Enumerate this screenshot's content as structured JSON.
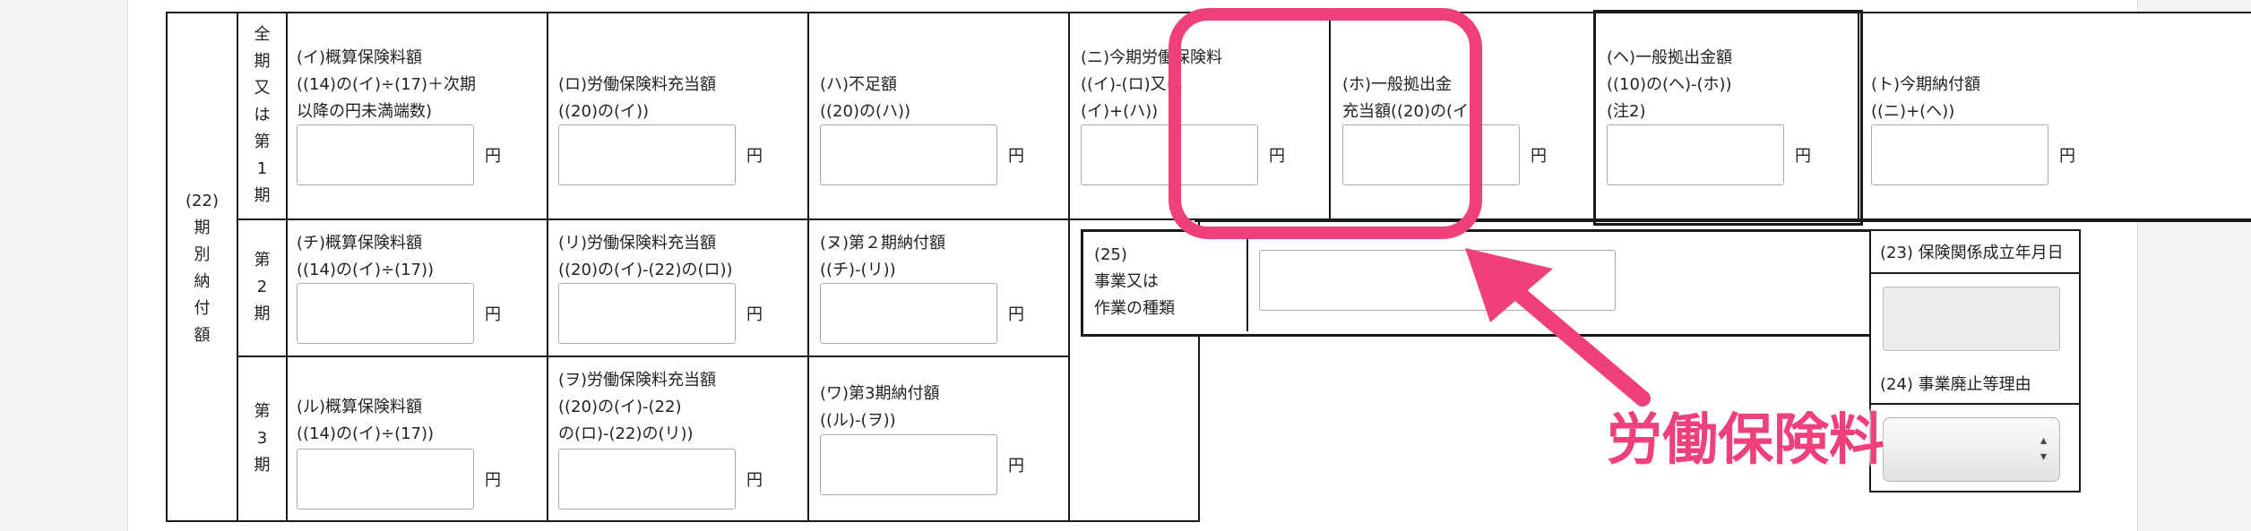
{
  "period_section": {
    "label_num": "(22)",
    "label_chars": [
      "期",
      "別",
      "納",
      "付",
      "額"
    ],
    "unit": "円",
    "rows": [
      {
        "label_chars": [
          "全",
          "期",
          "又",
          "は",
          "第",
          "1",
          "期"
        ],
        "cells": [
          {
            "lines": [
              "(イ)概算保険料額",
              "((14)の(イ)÷(17)＋次期",
              "以降の円未満端数)"
            ],
            "value": ""
          },
          {
            "lines": [
              "(ロ)労働保険料充当額",
              "((20)の(イ))"
            ],
            "value": ""
          },
          {
            "lines": [
              "(ハ)不足額",
              "((20)の(ハ))"
            ],
            "value": ""
          },
          {
            "lines": [
              "(ニ)今期労働保険料",
              "((イ)-(ロ)又は",
              "(イ)+(ハ))"
            ],
            "value": ""
          },
          {
            "lines": [
              "(ホ)一般拠出金",
              "充当額((20)の(イ))"
            ],
            "value": ""
          },
          {
            "lines": [
              "(ヘ)一般拠出金額",
              "((10)の(ヘ)-(ホ))",
              "(注2)"
            ],
            "value": ""
          },
          {
            "lines": [
              "(ト)今期納付額",
              "((ニ)+(ヘ))"
            ],
            "value": ""
          }
        ]
      },
      {
        "label_chars": [
          "第",
          "2",
          "期"
        ],
        "cells": [
          {
            "lines": [
              "(チ)概算保険料額",
              "((14)の(イ)÷(17))"
            ],
            "value": ""
          },
          {
            "lines": [
              "(リ)労働保険料充当額",
              "((20)の(イ)-(22)の(ロ))"
            ],
            "value": ""
          },
          {
            "lines": [
              "(ヌ)第２期納付額",
              "((チ)-(リ))"
            ],
            "value": ""
          }
        ]
      },
      {
        "label_chars": [
          "第",
          "3",
          "期"
        ],
        "cells": [
          {
            "lines": [
              "(ル)概算保険料額",
              "((14)の(イ)÷(17))"
            ],
            "value": ""
          },
          {
            "lines": [
              "(ヲ)労働保険料充当額",
              "((20)の(イ)-(22)",
              "の(ロ)-(22)の(リ))"
            ],
            "value": ""
          },
          {
            "lines": [
              "(ワ)第3期納付額",
              "((ル)-(ヲ))"
            ],
            "value": ""
          }
        ]
      }
    ]
  },
  "business_type": {
    "lines": [
      "(25)",
      "事業又は",
      "作業の種類"
    ],
    "value": ""
  },
  "established_date": {
    "label": "(23) 保険関係成立年月日",
    "value": ""
  },
  "abolition_reason": {
    "label": "(24) 事業廃止等理由",
    "selected": ""
  },
  "annotation": {
    "callout_text": "労働保険料",
    "color": "#f0407a"
  }
}
